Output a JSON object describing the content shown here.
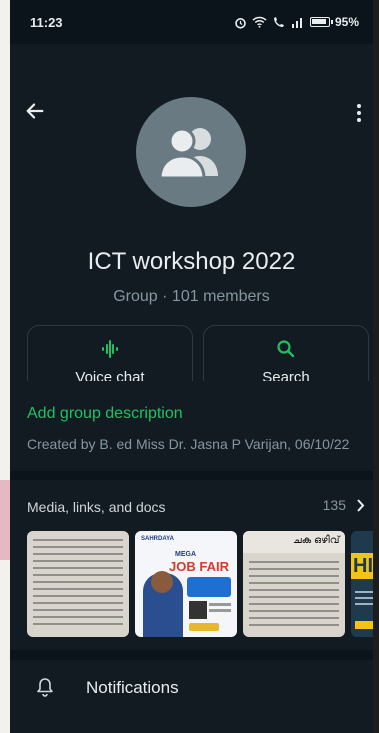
{
  "status_bar": {
    "time": "11:23",
    "battery": "95%",
    "icons": [
      "alarm-icon",
      "wifi-icon",
      "call-signal-icon",
      "cell-signal-icon",
      "battery-icon"
    ]
  },
  "header": {
    "back_icon": "back-arrow-icon",
    "menu_icon": "more-vert-icon",
    "avatar_icon": "group-icon"
  },
  "group": {
    "name": "ICT workshop 2022",
    "meta": "Group · 101 members"
  },
  "actions": [
    {
      "label": "Voice chat",
      "icon": "voice-wave-icon"
    },
    {
      "label": "Search",
      "icon": "search-icon"
    }
  ],
  "description": {
    "add_label": "Add group description",
    "created_by": "Created by B. ed Miss Dr. Jasna P Varijan, 06/10/22"
  },
  "media": {
    "title": "Media, links, and docs",
    "count": "135",
    "poster": {
      "brand": "SAHRDAYA",
      "heading": "MEGA",
      "title": "JOB FAIR"
    },
    "thumb4_banner": "ചക ഒഴിവ്",
    "thumb5_text": "HI"
  },
  "notifications": {
    "label": "Notifications",
    "icon": "bell-icon"
  },
  "colors": {
    "accent_green": "#21c063",
    "background": "#0b141a",
    "panel": "#111b21",
    "secondary_text": "#8696a0"
  }
}
